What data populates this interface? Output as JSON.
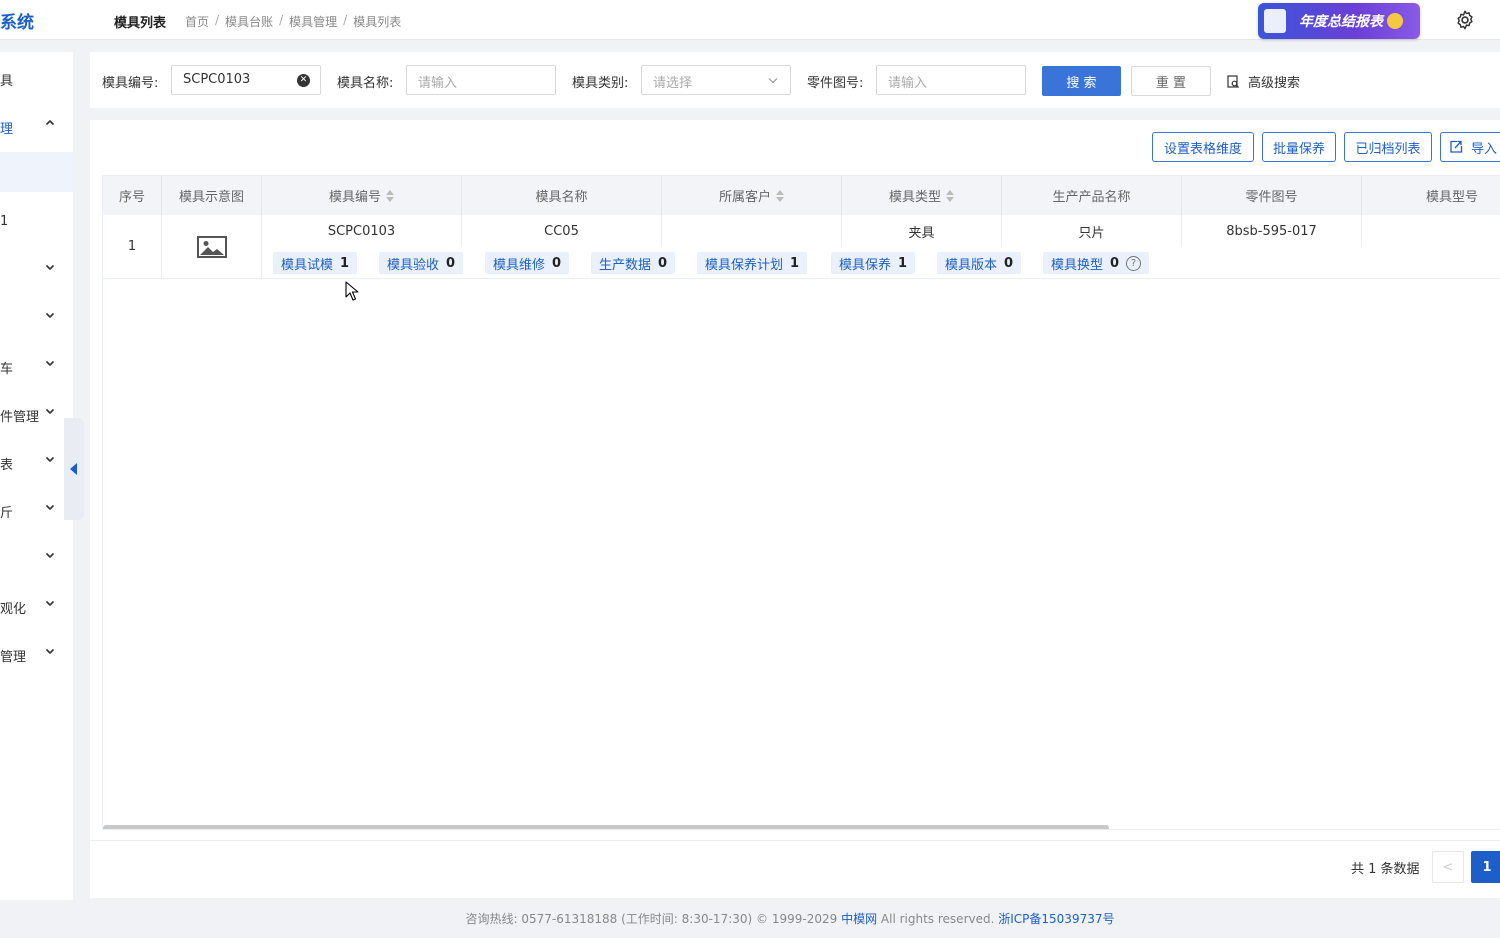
{
  "header": {
    "logo": "系统",
    "title": "模具列表",
    "breadcrumb": [
      "首页",
      "模具台账",
      "模具管理",
      "模具列表"
    ],
    "banner_text": "年度总结报表"
  },
  "sidebar": {
    "items": [
      {
        "label": "具",
        "chevron": false
      },
      {
        "label": "理",
        "chevron": "up",
        "active": true
      },
      {
        "label": "1",
        "chevron": false
      },
      {
        "label": "",
        "chevron": "down"
      },
      {
        "label": "",
        "chevron": "down"
      },
      {
        "label": "车",
        "chevron": "down"
      },
      {
        "label": "件管理",
        "chevron": "down"
      },
      {
        "label": "表",
        "chevron": "down"
      },
      {
        "label": "斤",
        "chevron": "down"
      },
      {
        "label": "",
        "chevron": "down"
      },
      {
        "label": "观化",
        "chevron": "down"
      },
      {
        "label": "管理",
        "chevron": "down"
      }
    ]
  },
  "search": {
    "code_label": "模具编号:",
    "code_value": "SCPC0103",
    "name_label": "模具名称:",
    "name_placeholder": "请输入",
    "category_label": "模具类别:",
    "category_placeholder": "请选择",
    "part_label": "零件图号:",
    "part_placeholder": "请输入",
    "search_btn": "搜 索",
    "reset_btn": "重 置",
    "advanced": "高级搜索"
  },
  "toolbar": {
    "set_dimension": "设置表格维度",
    "batch_maintain": "批量保养",
    "archived_list": "已归档列表",
    "import": "导入"
  },
  "table": {
    "headers": [
      "序号",
      "模具示意图",
      "模具编号",
      "模具名称",
      "所属客户",
      "模具类型",
      "生产产品名称",
      "零件图号",
      "模具型号"
    ],
    "row": {
      "index": "1",
      "code": "SCPC0103",
      "name": "CC05",
      "customer": "",
      "type": "夹具",
      "product": "只片",
      "part_no": "8bsb-595-017",
      "model": ""
    },
    "tags": [
      {
        "label": "模具试模",
        "count": "1"
      },
      {
        "label": "模具验收",
        "count": "0"
      },
      {
        "label": "模具维修",
        "count": "0"
      },
      {
        "label": "生产数据",
        "count": "0"
      },
      {
        "label": "模具保养计划",
        "count": "1"
      },
      {
        "label": "模具保养",
        "count": "1"
      },
      {
        "label": "模具版本",
        "count": "0"
      },
      {
        "label": "模具换型",
        "count": "0"
      }
    ]
  },
  "pagination": {
    "total": "共 1 条数据",
    "prev": "<",
    "current": "1"
  },
  "footer": {
    "hotline": "咨询热线: 0577-61318188 (工作时间: 8:30-17:30) © 1999-2029",
    "brand": "中模网",
    "rights": "All rights reserved.",
    "icp": "浙ICP备15039737号"
  }
}
